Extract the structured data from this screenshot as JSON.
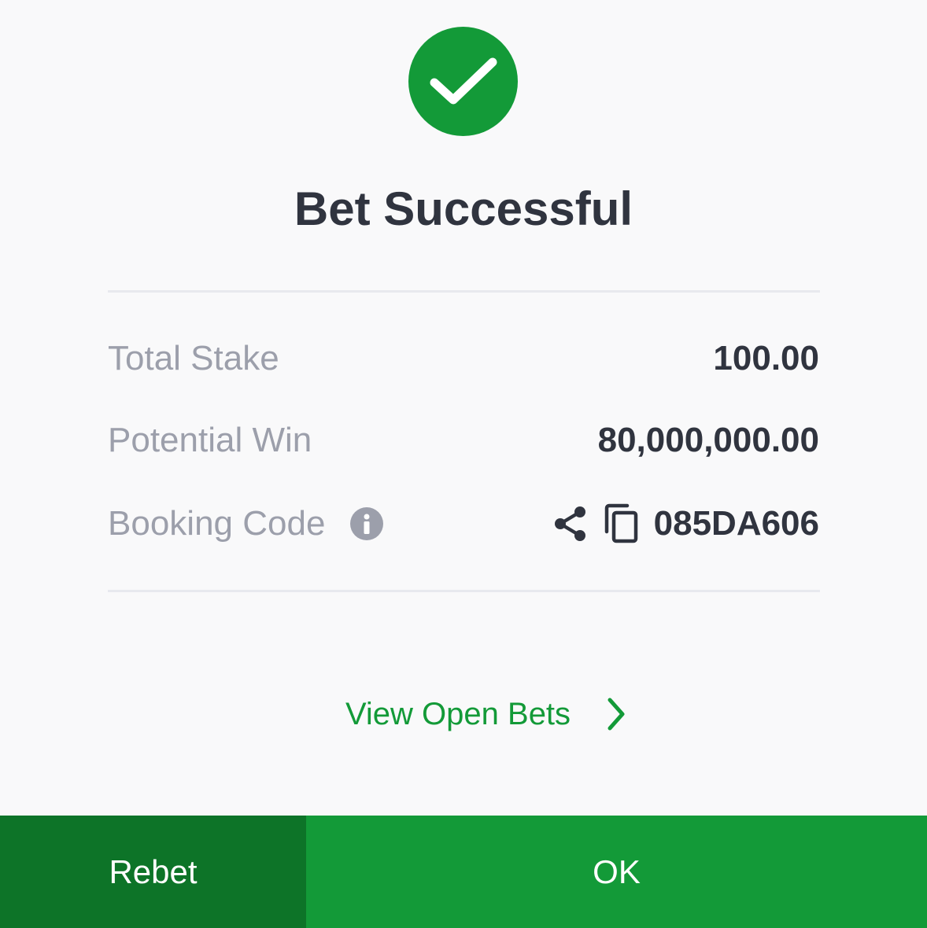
{
  "header": {
    "status_icon": "checkmark-icon",
    "title": "Bet Successful"
  },
  "summary": {
    "total_stake_label": "Total Stake",
    "total_stake_value": "100.00",
    "potential_win_label": "Potential Win",
    "potential_win_value": "80,000,000.00",
    "booking_code_label": "Booking Code",
    "booking_code_value": "085DA606",
    "icons": [
      "info-icon",
      "share-icon",
      "copy-icon"
    ]
  },
  "links": {
    "view_open_bets": "View Open Bets"
  },
  "footer": {
    "rebet_label": "Rebet",
    "ok_label": "OK"
  },
  "colors": {
    "accent": "#139a38",
    "accent_dark": "#0d7428",
    "text_dark": "#30343f",
    "text_muted": "#9c9fab",
    "divider": "#e8e9ee",
    "background": "#f9f9fa"
  }
}
